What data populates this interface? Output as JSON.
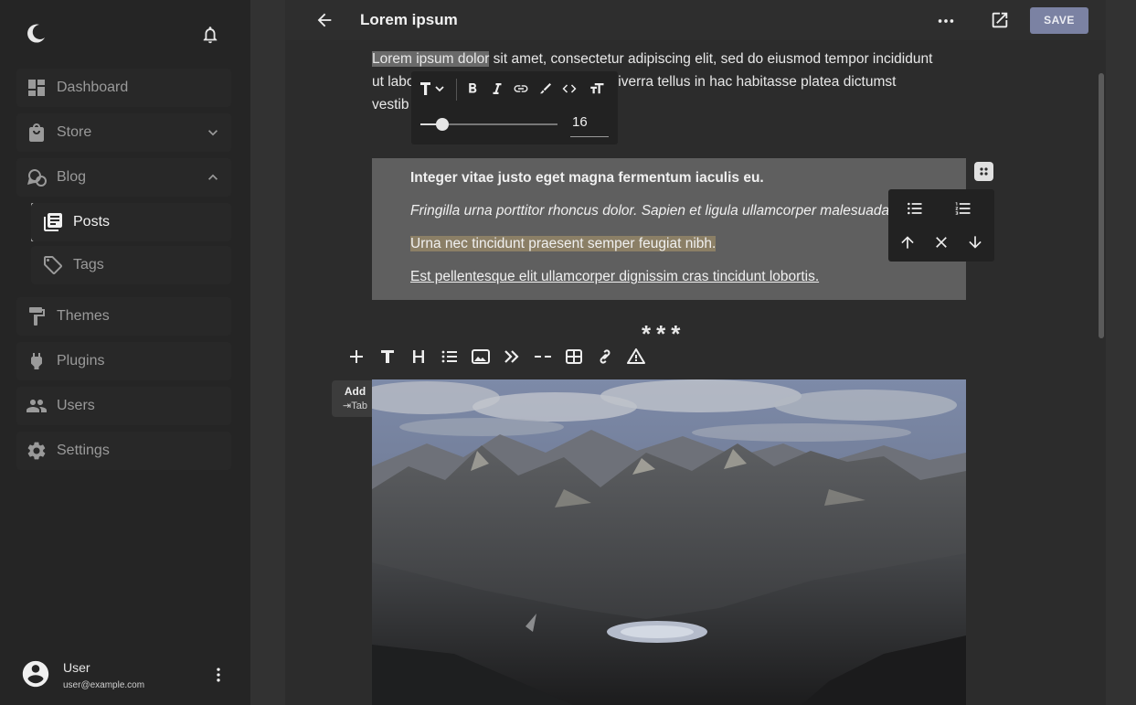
{
  "sidebar": {
    "items": [
      {
        "label": "Dashboard"
      },
      {
        "label": "Store"
      },
      {
        "label": "Blog"
      },
      {
        "label": "Posts"
      },
      {
        "label": "Tags"
      },
      {
        "label": "Themes"
      },
      {
        "label": "Plugins"
      },
      {
        "label": "Users"
      },
      {
        "label": "Settings"
      }
    ],
    "user": {
      "name": "User",
      "email": "user@example.com"
    }
  },
  "editor": {
    "title": "Lorem ipsum",
    "save_label": "SAVE",
    "paragraph": {
      "selected": "Lorem ipsum dolor",
      "line1_rest": " sit amet, consectetur adipiscing elit, sed do eiusmod tempor incididunt",
      "line2_a": "ut labo",
      "line2_b": "viverra tellus in hac habitasse platea dictumst",
      "line3": "vestib"
    },
    "format_popup": {
      "font_size": "16",
      "font_size_fraction": 0.16
    },
    "list": [
      "Integer vitae justo eget magna fermentum iaculis eu.",
      "Fringilla urna porttitor rhoncus dolor. Sapien et ligula ullamcorper malesuada",
      "Urna nec tincidunt praesent semper feugiat nibh.",
      "Est pellentesque elit ullamcorper dignissim cras tincidunt lobortis."
    ],
    "divider": "***",
    "tooltip": {
      "title": "Add",
      "shortcut": "⇥Tab"
    }
  },
  "colors": {
    "background": "#323232",
    "sidebar": "#252525",
    "editor_bg": "#2c2c2c",
    "save_button": "#7b82a3",
    "selection": "#5f5f5f",
    "highlight": "#8b7f66"
  },
  "icons": [
    "logo-icon",
    "bell-icon",
    "dashboard-icon",
    "store-icon",
    "chevron-down-icon",
    "blog-icon",
    "chevron-up-icon",
    "posts-icon",
    "tag-icon",
    "themes-icon",
    "plugins-icon",
    "users-icon",
    "settings-icon",
    "avatar-icon",
    "more-vert-icon",
    "back-arrow-icon",
    "more-horiz-icon",
    "open-external-icon",
    "text-style-icon",
    "bold-icon",
    "italic-icon",
    "link-icon",
    "highlight-icon",
    "code-icon",
    "font-size-icon",
    "drag-handle-icon",
    "bulleted-list-icon",
    "numbered-list-icon",
    "move-up-icon",
    "delete-icon",
    "move-down-icon",
    "add-icon",
    "text-icon",
    "heading-icon",
    "list-icon",
    "image-icon",
    "quote-icon",
    "divider-icon",
    "table-icon",
    "embed-link-icon",
    "warning-icon"
  ]
}
